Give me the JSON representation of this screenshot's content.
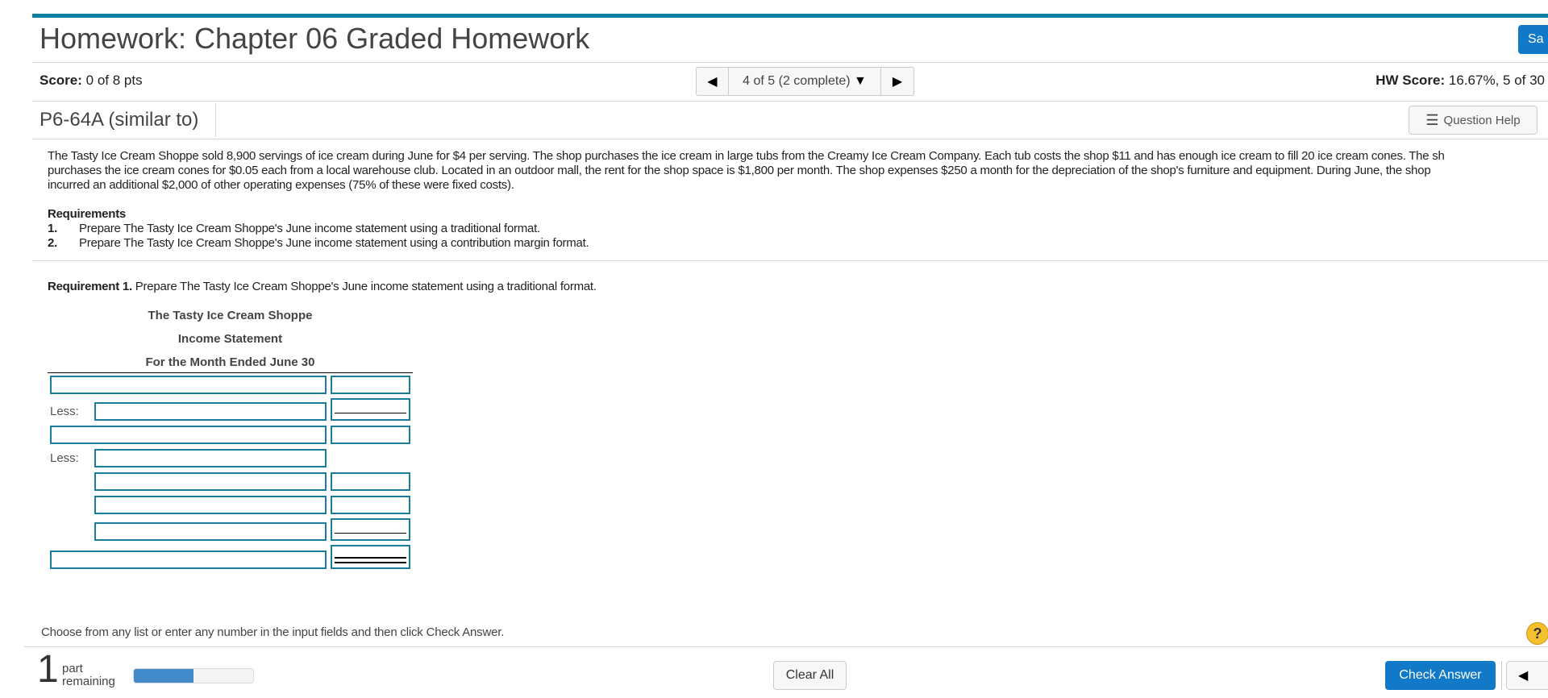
{
  "header": {
    "title": "Homework: Chapter 06 Graded Homework",
    "save_label": "Sa"
  },
  "score": {
    "label": "Score:",
    "value": "0 of 8 pts",
    "hw_label": "HW Score:",
    "hw_value": "16.67%, 5 of 30"
  },
  "nav": {
    "position": "4 of 5 (2 complete)"
  },
  "question": {
    "id": "P6-64A (similar to)",
    "help_label": "Question Help"
  },
  "problem": {
    "lines": [
      "The Tasty Ice Cream Shoppe sold 8,900 servings of ice cream during June for $4 per serving. The shop purchases the ice cream in large tubs from the Creamy Ice Cream Company. Each tub costs the shop $11 and has enough ice cream to fill 20 ice cream cones. The sh",
      "purchases the ice cream cones for $0.05 each from a local warehouse club. Located in an outdoor mall, the rent for the shop space is $1,800 per month. The shop expenses $250 a month for the depreciation of the shop's furniture and equipment. During June, the shop",
      "incurred an additional $2,000 of other operating expenses (75% of these were fixed costs)."
    ]
  },
  "requirements": {
    "title": "Requirements",
    "items": [
      {
        "num": "1.",
        "text": "Prepare The Tasty Ice Cream Shoppe's June income statement using a traditional format."
      },
      {
        "num": "2.",
        "text": "Prepare The Tasty Ice Cream Shoppe's June income statement using a contribution margin format."
      }
    ]
  },
  "req1": {
    "label": "Requirement 1.",
    "text": "Prepare The Tasty Ice Cream Shoppe's June income statement using a traditional format."
  },
  "statement": {
    "company": "The Tasty Ice Cream Shoppe",
    "title": "Income Statement",
    "period": "For the Month Ended June 30",
    "less_label": "Less:"
  },
  "footer": {
    "instruction": "Choose from any list or enter any number in the input fields and then click Check Answer.",
    "parts_count": "1",
    "parts_label_1": "part",
    "parts_label_2": "remaining",
    "progress_percent": 50,
    "clear_label": "Clear All",
    "check_label": "Check Answer"
  },
  "colors": {
    "accent": "#0b7da0",
    "button": "#1279c8",
    "input_border": "#1a7d9c",
    "progress": "#428bca"
  }
}
